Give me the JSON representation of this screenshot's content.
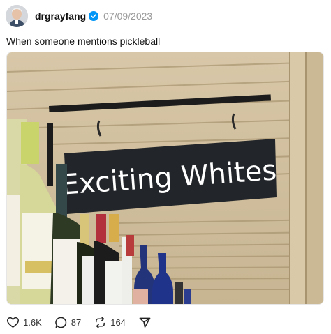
{
  "post": {
    "username": "drgrayfang",
    "date": "07/09/2023",
    "caption": "When someone mentions pickleball",
    "image": {
      "sign_text": "Exciting Whites"
    }
  },
  "actions": {
    "likes": "1.6K",
    "replies": "87",
    "reposts": "164"
  },
  "colors": {
    "verified": "#0095f6",
    "date_text": "#999999",
    "sign_background": "#222529"
  },
  "icons": [
    "verified-icon",
    "heart-icon",
    "reply-icon",
    "repost-icon",
    "share-icon"
  ]
}
